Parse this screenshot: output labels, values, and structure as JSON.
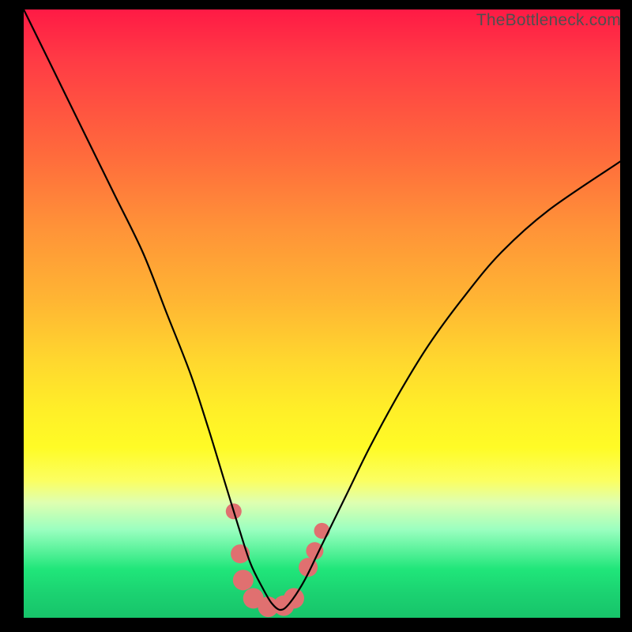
{
  "watermark": "TheBottleneck.com",
  "chart_data": {
    "type": "line",
    "title": "",
    "xlabel": "",
    "ylabel": "",
    "xlim": [
      0,
      100
    ],
    "ylim": [
      0,
      100
    ],
    "series": [
      {
        "name": "bottleneck-curve",
        "x": [
          0,
          5,
          10,
          15,
          20,
          24,
          28,
          31,
          33.5,
          36,
          38,
          40,
          41.5,
          43,
          44.5,
          47,
          50,
          54,
          58,
          63,
          68,
          74,
          80,
          88,
          100
        ],
        "y": [
          100,
          90,
          80,
          70,
          60,
          50,
          40,
          31,
          23,
          15,
          9,
          5,
          2.5,
          1.3,
          2.3,
          6,
          12,
          20,
          28,
          37,
          45,
          53,
          60,
          67,
          75
        ]
      }
    ],
    "markers": {
      "name": "highlight-points",
      "color": "#e07070",
      "points": [
        {
          "x": 35.2,
          "y": 17.5,
          "r": 10
        },
        {
          "x": 36.3,
          "y": 10.5,
          "r": 12
        },
        {
          "x": 36.8,
          "y": 6.2,
          "r": 13
        },
        {
          "x": 38.5,
          "y": 3.2,
          "r": 13
        },
        {
          "x": 41.0,
          "y": 1.8,
          "r": 13
        },
        {
          "x": 43.6,
          "y": 2.0,
          "r": 13
        },
        {
          "x": 45.3,
          "y": 3.2,
          "r": 13
        },
        {
          "x": 47.7,
          "y": 8.3,
          "r": 12
        },
        {
          "x": 48.8,
          "y": 11.0,
          "r": 11
        },
        {
          "x": 50.0,
          "y": 14.3,
          "r": 10
        }
      ]
    }
  }
}
